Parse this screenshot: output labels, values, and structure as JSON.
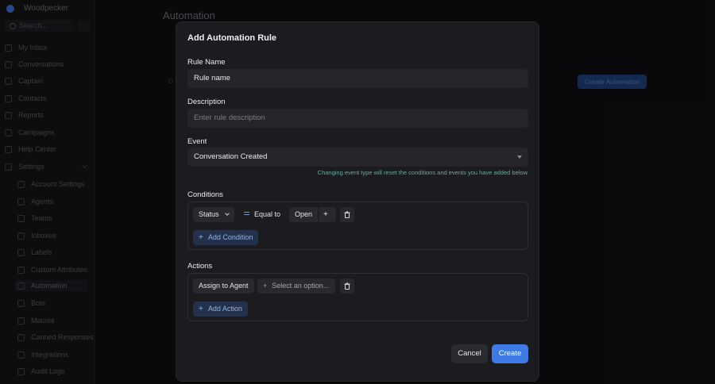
{
  "app": {
    "name": "Woodpecker"
  },
  "sidebar": {
    "search_placeholder": "Search...",
    "items": [
      {
        "label": "My Inbox",
        "icon": "inbox-icon"
      },
      {
        "label": "Conversations",
        "icon": "chat-icon"
      },
      {
        "label": "Captain",
        "icon": "bot-icon"
      },
      {
        "label": "Contacts",
        "icon": "contacts-icon"
      },
      {
        "label": "Reports",
        "icon": "chart-icon"
      },
      {
        "label": "Campaigns",
        "icon": "megaphone-icon"
      },
      {
        "label": "Help Center",
        "icon": "book-icon"
      },
      {
        "label": "Settings",
        "icon": "gear-icon"
      }
    ],
    "settings_items": [
      {
        "label": "Account Settings"
      },
      {
        "label": "Agents"
      },
      {
        "label": "Teams"
      },
      {
        "label": "Inboxes"
      },
      {
        "label": "Labels"
      },
      {
        "label": "Custom Attributes"
      },
      {
        "label": "Automation"
      },
      {
        "label": "Bots"
      },
      {
        "label": "Macros"
      },
      {
        "label": "Canned Responses"
      },
      {
        "label": "Integrations"
      },
      {
        "label": "Audit Logs"
      }
    ]
  },
  "page": {
    "title": "Automation",
    "create_button": "Create Automation"
  },
  "modal": {
    "title": "Add Automation Rule",
    "rule_name": {
      "label": "Rule Name",
      "value": "Rule name"
    },
    "description": {
      "label": "Description",
      "placeholder": "Enter rule description"
    },
    "event": {
      "label": "Event",
      "selected": "Conversation Created",
      "hint": "Changing event type will reset the conditions and events you have added below"
    },
    "conditions": {
      "label": "Conditions",
      "attribute": "Status",
      "operator": "Equal to",
      "value": "Open",
      "add_label": "Add Condition"
    },
    "actions": {
      "label": "Actions",
      "action": "Assign to Agent",
      "option_placeholder": "Select an option...",
      "add_label": "Add Action"
    },
    "cancel_label": "Cancel",
    "create_label": "Create"
  },
  "colors": {
    "accent": "#3e7be6",
    "hint": "#6aa8a0",
    "add_button_text": "#8fb2ea"
  }
}
